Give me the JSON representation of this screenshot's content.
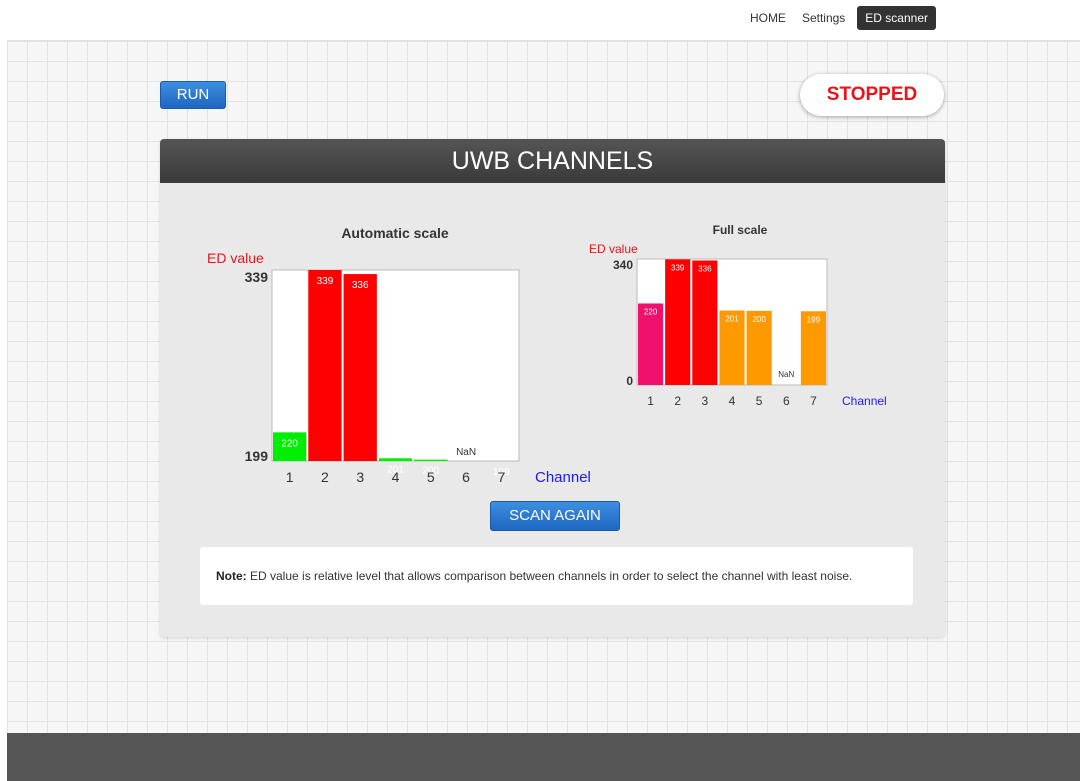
{
  "nav": {
    "items": [
      {
        "label": "HOME",
        "active": false
      },
      {
        "label": "Settings",
        "active": false
      },
      {
        "label": "ED scanner",
        "active": true
      }
    ]
  },
  "controls": {
    "run_label": "RUN",
    "status_label": "STOPPED",
    "status_color": "#e8141b"
  },
  "panel": {
    "title": "UWB CHANNELS",
    "scan_label": "SCAN AGAIN",
    "note_label": "Note:",
    "note_text": " ED value is relative level that allows comparison between channels in order to select the channel with least noise."
  },
  "chart_data": [
    {
      "type": "bar",
      "title": "Automatic scale",
      "ylabel": "ED value",
      "xlabel": "Channel",
      "ylim": [
        199,
        339
      ],
      "ytick_labels": [
        "339",
        "199"
      ],
      "categories": [
        "1",
        "2",
        "3",
        "4",
        "5",
        "6",
        "7"
      ],
      "values": [
        220,
        339,
        336,
        201,
        200,
        null,
        199
      ],
      "value_labels": [
        "220",
        "339",
        "336",
        "201",
        "200",
        "NaN",
        "199"
      ],
      "colors": [
        "#00ee00",
        "#ff0000",
        "#ff0000",
        "#00ee00",
        "#00ee00",
        "#ffffff",
        "#00ee00"
      ],
      "grid": false
    },
    {
      "type": "bar",
      "title": "Full scale",
      "ylabel": "ED value",
      "xlabel": "Channel",
      "ylim": [
        0,
        340
      ],
      "ytick_labels": [
        "340",
        "0"
      ],
      "categories": [
        "1",
        "2",
        "3",
        "4",
        "5",
        "6",
        "7"
      ],
      "values": [
        220,
        339,
        336,
        201,
        200,
        null,
        199
      ],
      "value_labels": [
        "220",
        "339",
        "336",
        "201",
        "200",
        "NaN",
        "199"
      ],
      "colors": [
        "#f0116c",
        "#ff0000",
        "#ff0000",
        "#ff9900",
        "#ff9900",
        "#ffffff",
        "#ff9900"
      ],
      "grid": false
    }
  ]
}
